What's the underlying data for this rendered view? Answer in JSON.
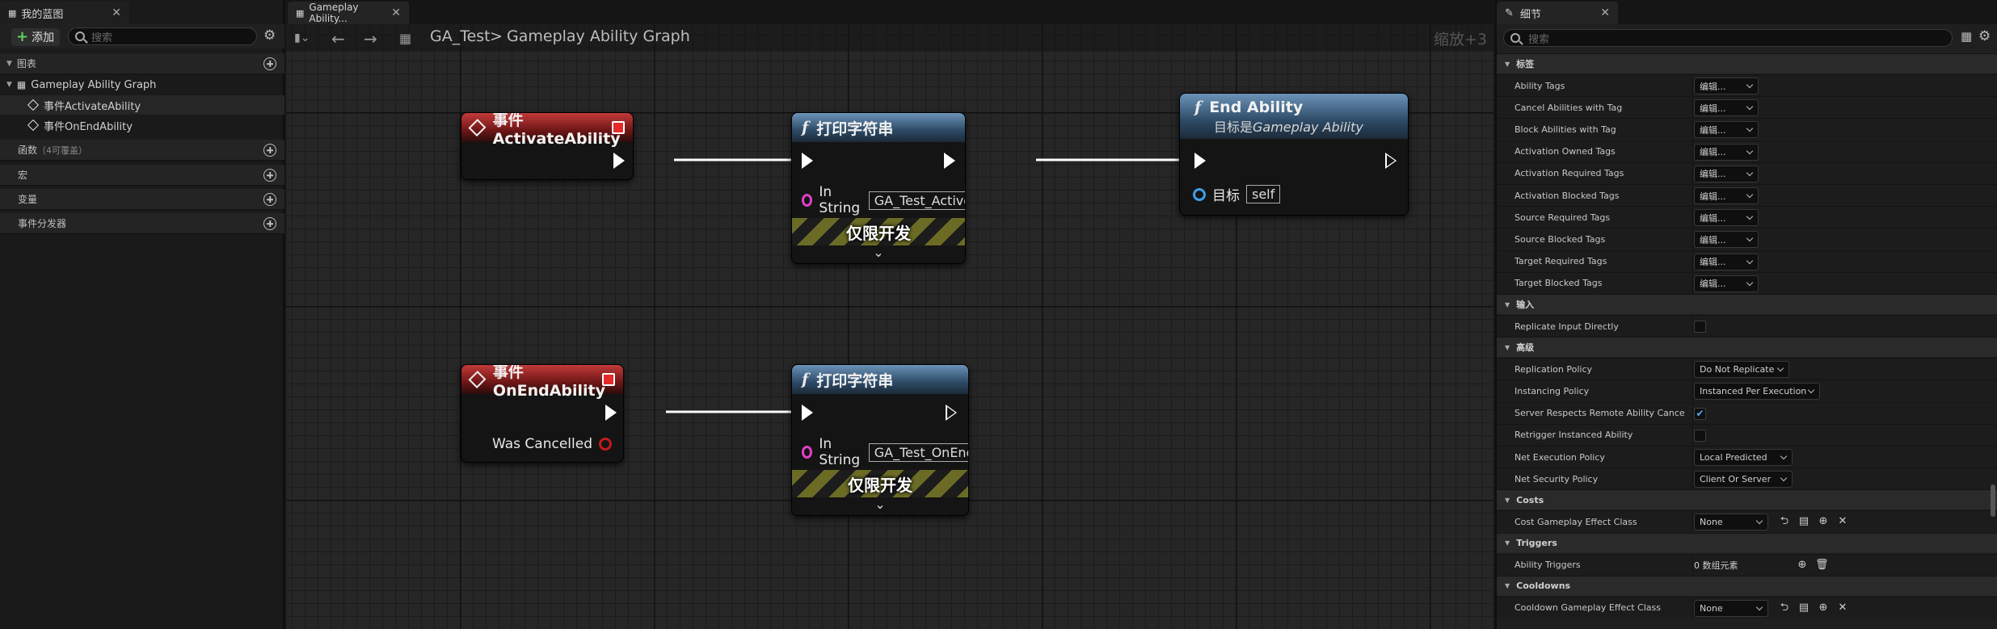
{
  "left_panel": {
    "tab_title": "我的蓝图",
    "add_label": "添加",
    "search_placeholder": "搜索",
    "sections": {
      "graphs": "图表",
      "functions": "函数",
      "functions_note": "（4可覆盖）",
      "macros": "宏",
      "variables": "变量",
      "dispatchers": "事件分发器"
    },
    "graph_tree": {
      "root": "Gameplay Ability Graph",
      "events": [
        "事件ActivateAbility",
        "事件OnEndAbility"
      ]
    }
  },
  "graph": {
    "tab_title": "Gameplay Ability...",
    "breadcrumb_root": "GA_Test",
    "breadcrumb_sep": ">",
    "breadcrumb_current": "Gameplay Ability Graph",
    "zoom": "缩放+3",
    "nodes": {
      "event_activate": {
        "title": "事件ActivateAbility"
      },
      "print1": {
        "title": "打印字符串",
        "pin_label": "In String",
        "pin_value": "GA_Test_Active",
        "dev_only": "仅限开发"
      },
      "end_ability": {
        "title": "End Ability",
        "subtitle_prefix": "目标是",
        "subtitle_target": "Gameplay Ability",
        "pin_label": "目标",
        "pin_value": "self"
      },
      "event_end": {
        "title": "事件OnEndAbility",
        "pin_label": "Was Cancelled"
      },
      "print2": {
        "title": "打印字符串",
        "pin_label": "In String",
        "pin_value": "GA_Test_OnEnd",
        "dev_only": "仅限开发"
      }
    }
  },
  "details": {
    "tab_title": "细节",
    "search_placeholder": "搜索",
    "categories": {
      "tags": "标签",
      "input": "输入",
      "advanced": "高级",
      "costs": "Costs",
      "triggers": "Triggers",
      "cooldowns": "Cooldowns"
    },
    "edit_label": "编辑...",
    "tag_rows": [
      "Ability Tags",
      "Cancel Abilities with Tag",
      "Block Abilities with Tag",
      "Activation Owned Tags",
      "Activation Required Tags",
      "Activation Blocked Tags",
      "Source Required Tags",
      "Source Blocked Tags",
      "Target Required Tags",
      "Target Blocked Tags"
    ],
    "input_rows": {
      "replicate_input": "Replicate Input Directly",
      "replicate_input_checked": false
    },
    "advanced_rows": {
      "replication_policy": {
        "label": "Replication Policy",
        "value": "Do Not Replicate"
      },
      "instancing_policy": {
        "label": "Instancing Policy",
        "value": "Instanced Per Execution"
      },
      "server_respects": {
        "label": "Server Respects Remote Ability Cancell...",
        "checked": true
      },
      "retrigger": {
        "label": "Retrigger Instanced Ability",
        "checked": false
      },
      "net_execution": {
        "label": "Net Execution Policy",
        "value": "Local Predicted"
      },
      "net_security": {
        "label": "Net Security Policy",
        "value": "Client Or Server"
      }
    },
    "cost_row": {
      "label": "Cost Gameplay Effect Class",
      "value": "None"
    },
    "trigger_row": {
      "label": "Ability Triggers",
      "value": "0 数组元素"
    },
    "cooldown_row": {
      "label": "Cooldown Gameplay Effect Class",
      "value": "None"
    }
  }
}
